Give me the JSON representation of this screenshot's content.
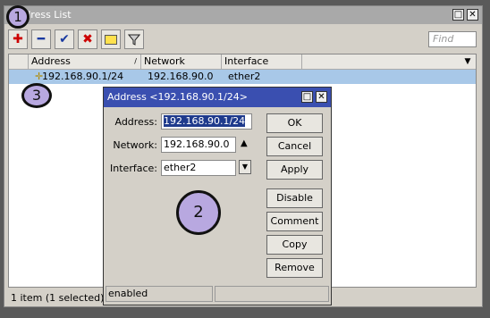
{
  "window": {
    "title": "Address List"
  },
  "toolbar": {
    "find_placeholder": "Find"
  },
  "table": {
    "columns": [
      "Address",
      "Network",
      "Interface"
    ],
    "rows": [
      {
        "address": "192.168.90.1/24",
        "network": "192.168.90.0",
        "interface": "ether2"
      }
    ]
  },
  "status": {
    "text": "1 item (1 selected)"
  },
  "dialog": {
    "title": "Address <192.168.90.1/24>",
    "address_label": "Address:",
    "address_value": "192.168.90.1/24",
    "network_label": "Network:",
    "network_value": "192.168.90.0",
    "interface_label": "Interface:",
    "interface_value": "ether2",
    "buttons": {
      "ok": "OK",
      "cancel": "Cancel",
      "apply": "Apply",
      "disable": "Disable",
      "comment": "Comment",
      "copy": "Copy",
      "remove": "Remove"
    },
    "status": "enabled"
  },
  "annotations": {
    "one": "1",
    "two": "2",
    "three": "3"
  }
}
